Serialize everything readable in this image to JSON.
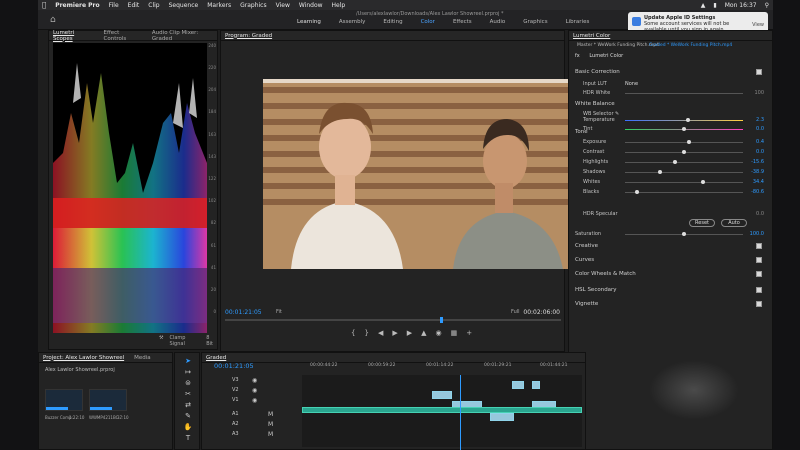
{
  "menubar": {
    "app": "Premiere Pro",
    "items": [
      "File",
      "Edit",
      "Clip",
      "Sequence",
      "Markers",
      "Graphics",
      "View",
      "Window",
      "Help"
    ],
    "clock": "Mon 16:37"
  },
  "window": {
    "path": "/Users/alexlawlor/Downloads/Alex Lawlor Showreel.prproj *",
    "workspaces": [
      "Learning",
      "Assembly",
      "Editing",
      "Color",
      "Effects",
      "Audio",
      "Graphics",
      "Libraries"
    ]
  },
  "notification": {
    "title": "Update Apple ID Settings",
    "body": "Some account services will not be available until you sign in again.",
    "view": "View"
  },
  "scopes": {
    "tabs": [
      "Lumetri Scopes",
      "Effect Controls",
      "Audio Clip Mixer: Graded"
    ],
    "ticks": [
      "240",
      "220",
      "204",
      "184",
      "163",
      "143",
      "122",
      "102",
      "82",
      "61",
      "41",
      "20",
      "0"
    ],
    "clamp": "Clamp Signal",
    "bits": "8 Bit"
  },
  "program": {
    "title": "Program: Graded",
    "timecode": "00:01:21:05",
    "fit": "Fit",
    "quality": "Full",
    "duration": "00:02:06:00"
  },
  "lumetri": {
    "tab": "Lumetri Color",
    "master": "Master * WeWork Funding Pitch.mp4",
    "graded": "Graded * WeWork Funding Pitch.mp4",
    "effect": "Lumetri Color",
    "basic": "Basic Correction",
    "input_lut_label": "Input LUT",
    "input_lut_value": "None",
    "hdr_white_label": "HDR White",
    "hdr_white_value": "100",
    "white_balance": "White Balance",
    "wb_selector": "WB Selector",
    "tone": "Tone",
    "hdr_specular_label": "HDR Specular",
    "hdr_specular_value": "0.0",
    "reset": "Reset",
    "auto": "Auto",
    "saturation_label": "Saturation",
    "saturation_value": "100.0",
    "sliders": [
      {
        "label": "Temperature",
        "value": "2.3",
        "pos": 0.53
      },
      {
        "label": "Tint",
        "value": "0.0",
        "pos": 0.5
      },
      {
        "label": "Exposure",
        "value": "0.4",
        "pos": 0.54
      },
      {
        "label": "Contrast",
        "value": "0.0",
        "pos": 0.5
      },
      {
        "label": "Highlights",
        "value": "-15.6",
        "pos": 0.42
      },
      {
        "label": "Shadows",
        "value": "-38.9",
        "pos": 0.3
      },
      {
        "label": "Whites",
        "value": "34.4",
        "pos": 0.66
      },
      {
        "label": "Blacks",
        "value": "-80.6",
        "pos": 0.1
      }
    ],
    "sections": [
      "Creative",
      "Curves",
      "Color Wheels & Match",
      "HSL Secondary",
      "Vignette"
    ]
  },
  "project": {
    "tabs": [
      "Project: Alex Lawlor Showreel",
      "Media"
    ],
    "file": "Alex Lawlor Showreel.prproj",
    "clips": [
      {
        "name": "Buzzer Comp...",
        "dur": "1:22:10"
      },
      {
        "name": "WWMP4211BC...",
        "dur": "37:10"
      }
    ]
  },
  "timeline": {
    "tab": "Graded",
    "timecode": "00:01:21:05",
    "ruler": [
      "00:00:44:22",
      "00:00:59:22",
      "00:01:14:22",
      "00:01:29:21",
      "00:01:44:21"
    ],
    "tracks": [
      "V3",
      "V2",
      "V1",
      "A1",
      "A2",
      "A3"
    ]
  }
}
